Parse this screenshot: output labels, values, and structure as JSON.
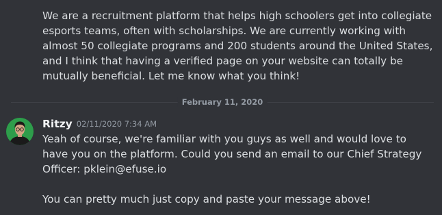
{
  "previous_message": {
    "text": "We are a recruitment platform that helps high schoolers get into collegiate esports teams, often with scholarships. We are currently working with almost 50 collegiate programs and 200 students around the United States, and I think that having a verified page on your website can totally be mutually beneficial. Let me know what you think!"
  },
  "date_divider": {
    "label": "February 11, 2020"
  },
  "message": {
    "username": "Ritzy",
    "timestamp": "02/11/2020 7:34 AM",
    "avatar_icon": "user-avatar-icon",
    "lines": [
      "Yeah of course, we're familiar with you guys as well and would love to have you on the platform. Could you send an email to our Chief Strategy Officer: pklein@efuse.io",
      "You can pretty much just copy and paste your message above!"
    ]
  },
  "colors": {
    "background": "#313338",
    "text": "#dbdee1",
    "username": "#f2f3f5",
    "muted": "#949ba4",
    "divider": "#3f4147"
  }
}
